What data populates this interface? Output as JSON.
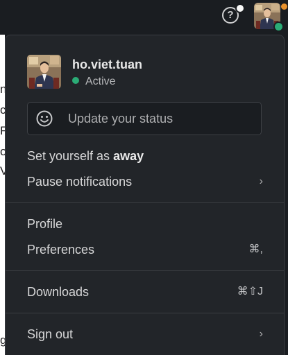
{
  "topbar": {
    "help_label": "?",
    "avatar_icon": "user-avatar-photo"
  },
  "menu": {
    "profile": {
      "username": "ho.viet.tuan",
      "presence": "Active",
      "presence_color": "#2bac76"
    },
    "status": {
      "placeholder": "Update your status",
      "icon": "smiley-icon"
    },
    "away": {
      "prefix": "Set yourself as ",
      "strong": "away"
    },
    "pause": {
      "label": "Pause notifications",
      "chevron": "›"
    },
    "profile_link": {
      "label": "Profile"
    },
    "preferences": {
      "label": "Preferences",
      "shortcut": "⌘,"
    },
    "downloads": {
      "label": "Downloads",
      "shortcut": "⌘⇧J"
    },
    "sign_out": {
      "label": "Sign out",
      "chevron": "›"
    }
  },
  "background": {
    "fragments": [
      "n",
      "c",
      "F",
      "o",
      "V",
      "g"
    ]
  },
  "colors": {
    "menu_bg": "#222529",
    "topbar_bg": "#1a1d21",
    "online": "#2bac76",
    "notification": "#e8912d"
  }
}
